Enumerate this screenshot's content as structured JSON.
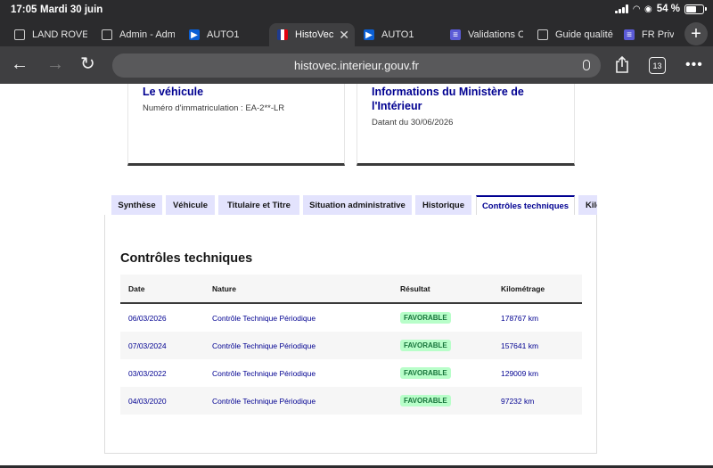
{
  "status_bar": {
    "time": "17:05",
    "date": "Mardi 30 juin",
    "battery": "54 %"
  },
  "browser": {
    "tabs": [
      {
        "label": "LAND ROVER",
        "icon": "globe-icon"
      },
      {
        "label": "Admin - Adm",
        "icon": "globe-icon"
      },
      {
        "label": "AUTO1",
        "icon": "auto1-icon"
      },
      {
        "label": "HistoVec",
        "icon": "marianne-flag-icon",
        "active": true
      },
      {
        "label": "AUTO1",
        "icon": "auto1-icon"
      },
      {
        "label": "Validations C",
        "icon": "form-icon"
      },
      {
        "label": "Guide qualité",
        "icon": "globe-icon"
      },
      {
        "label": "FR Priv",
        "icon": "form-icon"
      }
    ],
    "url": "histovec.interieur.gouv.fr",
    "tab_count": "13"
  },
  "cards": {
    "vehicle": {
      "title": "Le véhicule",
      "text": "Numéro d'immatriculation : EA-2**-LR"
    },
    "ministry": {
      "title": "Informations du Ministère de l'Intérieur",
      "text": "Datant du 30/06/2026"
    }
  },
  "page_tabs": [
    {
      "label": "Synthèse"
    },
    {
      "label": "Véhicule"
    },
    {
      "label": "Titulaire et Titre"
    },
    {
      "label": "Situation administrative"
    },
    {
      "label": "Historique"
    },
    {
      "label": "Contrôles techniques",
      "active": true
    },
    {
      "label": "Kilo"
    }
  ],
  "section": {
    "title": "Contrôles techniques",
    "columns": [
      "Date",
      "Nature",
      "Résultat",
      "Kilométrage"
    ],
    "rows": [
      {
        "date": "06/03/2026",
        "nature": "Contrôle Technique Périodique",
        "result": "FAVORABLE",
        "km": "178767 km"
      },
      {
        "date": "07/03/2024",
        "nature": "Contrôle Technique Périodique",
        "result": "FAVORABLE",
        "km": "157641 km"
      },
      {
        "date": "03/03/2022",
        "nature": "Contrôle Technique Périodique",
        "result": "FAVORABLE",
        "km": "129009 km"
      },
      {
        "date": "04/03/2020",
        "nature": "Contrôle Technique Périodique",
        "result": "FAVORABLE",
        "km": "97232 km"
      }
    ]
  },
  "colors": {
    "accent": "#000091",
    "tab_bg": "#e3e3fd",
    "badge_bg": "#b8fec9",
    "badge_text": "#18753c",
    "chrome": "#2b2b2d"
  }
}
